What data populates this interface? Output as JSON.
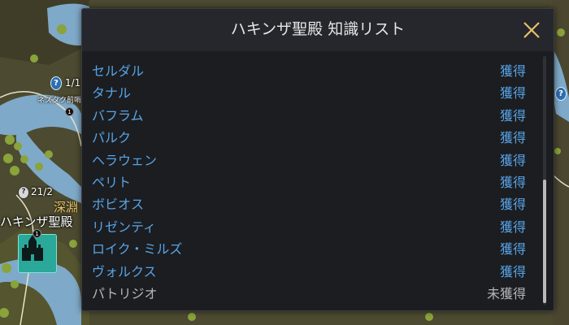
{
  "dialog": {
    "title": "ハキンザ聖殿 知識リスト",
    "close_icon": "close-icon",
    "items": [
      {
        "name": "セルダル",
        "status": "獲得",
        "acquired": true
      },
      {
        "name": "タナル",
        "status": "獲得",
        "acquired": true
      },
      {
        "name": "バフラム",
        "status": "獲得",
        "acquired": true
      },
      {
        "name": "パルク",
        "status": "獲得",
        "acquired": true
      },
      {
        "name": "ヘラウェン",
        "status": "獲得",
        "acquired": true
      },
      {
        "name": "ペリト",
        "status": "獲得",
        "acquired": true
      },
      {
        "name": "ボビオス",
        "status": "獲得",
        "acquired": true
      },
      {
        "name": "リゼンティ",
        "status": "獲得",
        "acquired": true
      },
      {
        "name": "ロイク・ミルズ",
        "status": "獲得",
        "acquired": true
      },
      {
        "name": "ヴォルクス",
        "status": "獲得",
        "acquired": true
      },
      {
        "name": "パトリジオ",
        "status": "未獲得",
        "acquired": false
      }
    ]
  },
  "map": {
    "quest_counter_1": "1/1",
    "quest_counter_2": "21/2",
    "small_label": "ネズタク前哨",
    "kanji_label": "深淵",
    "shrine_name": "ハキンザ聖殿",
    "colors": {
      "water": "#7fa9c8",
      "land": "#4c4a30",
      "accent_blue": "#58a4e6",
      "castle_teal": "#2aa89a"
    }
  }
}
